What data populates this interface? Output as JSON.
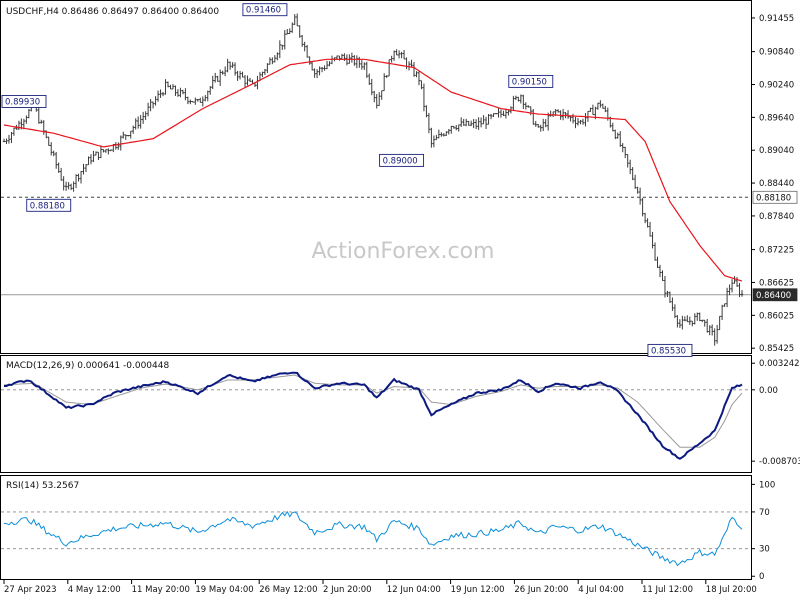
{
  "header": {
    "symbol_line": "USDCHF,H4  0.86486 0.86497 0.86400 0.86400"
  },
  "watermark": "ActionForex.com",
  "colors": {
    "candle": "#3a3a3a",
    "ma": "#e8151b",
    "macd": "#0c1a80",
    "macd_signal": "#9a9a9a",
    "rsi": "#0d8fd8",
    "label_border": "#1a237e",
    "label_text": "#1a237e",
    "current_price_bg": "#2b2b2b"
  },
  "chart_data": [
    {
      "type": "candlestick",
      "panel": "price",
      "y_ticks": [
        0.91455,
        0.9084,
        0.9024,
        0.8964,
        0.8904,
        0.8844,
        0.8784,
        0.87225,
        0.86625,
        0.86025,
        0.85425
      ],
      "y_tick_labels": [
        "0.91455",
        "0.90840",
        "0.90240",
        "0.89640",
        "0.89040",
        "0.88440",
        "0.87840",
        "0.87225",
        "0.86625",
        "0.86025",
        "0.85425"
      ],
      "ylim": [
        0.85355,
        0.9171
      ],
      "x_labels": [
        "27 Apr 2023",
        "4 May 12:00",
        "11 May 20:00",
        "19 May 04:00",
        "26 May 12:00",
        "2 Jun 20:00",
        "12 Jun 04:00",
        "19 Jun 12:00",
        "26 Jun 20:00",
        "4 Jul 04:00",
        "11 Jul 12:00",
        "18 Jul 20:00"
      ],
      "close_anchors": [
        [
          0,
          0.892
        ],
        [
          12,
          0.8985
        ],
        [
          25,
          0.883
        ],
        [
          35,
          0.889
        ],
        [
          45,
          0.8915
        ],
        [
          55,
          0.896
        ],
        [
          65,
          0.902
        ],
        [
          78,
          0.899
        ],
        [
          90,
          0.906
        ],
        [
          100,
          0.902
        ],
        [
          112,
          0.91
        ],
        [
          117,
          0.914
        ],
        [
          125,
          0.9045
        ],
        [
          135,
          0.9075
        ],
        [
          145,
          0.906
        ],
        [
          150,
          0.899
        ],
        [
          157,
          0.909
        ],
        [
          167,
          0.9035
        ],
        [
          172,
          0.8915
        ],
        [
          180,
          0.895
        ],
        [
          190,
          0.895
        ],
        [
          200,
          0.897
        ],
        [
          208,
          0.9005
        ],
        [
          215,
          0.894
        ],
        [
          222,
          0.8975
        ],
        [
          232,
          0.8955
        ],
        [
          240,
          0.899
        ],
        [
          247,
          0.8925
        ],
        [
          255,
          0.883
        ],
        [
          265,
          0.866
        ],
        [
          272,
          0.8585
        ],
        [
          280,
          0.86
        ],
        [
          286,
          0.856
        ],
        [
          290,
          0.863
        ],
        [
          293,
          0.8665
        ],
        [
          297,
          0.864
        ]
      ],
      "moving_average": {
        "period_label": "MA",
        "anchors": [
          [
            0,
            0.895
          ],
          [
            20,
            0.8935
          ],
          [
            40,
            0.891
          ],
          [
            60,
            0.8925
          ],
          [
            80,
            0.898
          ],
          [
            100,
            0.9025
          ],
          [
            115,
            0.906
          ],
          [
            130,
            0.907
          ],
          [
            145,
            0.907
          ],
          [
            165,
            0.9055
          ],
          [
            180,
            0.901
          ],
          [
            200,
            0.898
          ],
          [
            215,
            0.897
          ],
          [
            235,
            0.8965
          ],
          [
            250,
            0.896
          ],
          [
            258,
            0.892
          ],
          [
            268,
            0.881
          ],
          [
            280,
            0.873
          ],
          [
            290,
            0.8675
          ],
          [
            297,
            0.8665
          ]
        ]
      },
      "annotations": [
        {
          "text": "0.91460",
          "bar": 105,
          "price": 0.9146,
          "placement": "above"
        },
        {
          "text": "0.89930",
          "bar": 6,
          "price": 0.8993,
          "placement": "left-edge"
        },
        {
          "text": "0.89000",
          "bar": 160,
          "price": 0.89,
          "placement": "below"
        },
        {
          "text": "0.90150",
          "bar": 212,
          "price": 0.9015,
          "placement": "above"
        },
        {
          "text": "0.88180",
          "bar": 18,
          "price": 0.8818,
          "placement": "below"
        },
        {
          "text": "0.85530",
          "bar": 268,
          "price": 0.8553,
          "placement": "below"
        }
      ],
      "horizontal_lines": [
        {
          "price": 0.8818,
          "style": "dashed",
          "label": "0.88180"
        },
        {
          "price": 0.864,
          "style": "solid",
          "label": "0.86400",
          "current": true
        }
      ]
    },
    {
      "type": "line",
      "panel": "macd",
      "title": "MACD(12,26,9) 0.000641 -0.000448",
      "ylim": [
        -0.0099,
        0.004
      ],
      "y_tick_labels": [
        "0.003242",
        "0.00",
        "-0.008703"
      ],
      "y_ticks": [
        0.003242,
        0.0,
        -0.008703
      ],
      "series": [
        {
          "name": "MACD",
          "anchors": [
            [
              0,
              0.0005
            ],
            [
              10,
              0.0012
            ],
            [
              20,
              -0.001
            ],
            [
              25,
              -0.0022
            ],
            [
              35,
              -0.0018
            ],
            [
              45,
              -0.0003
            ],
            [
              55,
              0.0004
            ],
            [
              65,
              0.001
            ],
            [
              78,
              -0.0004
            ],
            [
              90,
              0.0018
            ],
            [
              100,
              0.001
            ],
            [
              112,
              0.002
            ],
            [
              117,
              0.0022
            ],
            [
              125,
              0.0002
            ],
            [
              135,
              0.0008
            ],
            [
              145,
              0.0006
            ],
            [
              150,
              -0.001
            ],
            [
              157,
              0.0012
            ],
            [
              167,
              0.0
            ],
            [
              172,
              -0.003
            ],
            [
              180,
              -0.0018
            ],
            [
              190,
              -0.0004
            ],
            [
              200,
              0.0
            ],
            [
              208,
              0.0012
            ],
            [
              215,
              -0.0002
            ],
            [
              222,
              0.0008
            ],
            [
              232,
              0.0002
            ],
            [
              240,
              0.001
            ],
            [
              247,
              -0.0002
            ],
            [
              255,
              -0.003
            ],
            [
              265,
              -0.0068
            ],
            [
              272,
              -0.0084
            ],
            [
              280,
              -0.0065
            ],
            [
              286,
              -0.005
            ],
            [
              290,
              -0.002
            ],
            [
              293,
              0.0002
            ],
            [
              297,
              0.0006
            ]
          ]
        },
        {
          "name": "Signal",
          "anchors": [
            [
              0,
              0.0006
            ],
            [
              12,
              0.0008
            ],
            [
              25,
              -0.0015
            ],
            [
              35,
              -0.0018
            ],
            [
              45,
              -0.0008
            ],
            [
              55,
              0.0002
            ],
            [
              65,
              0.0007
            ],
            [
              78,
              0.0
            ],
            [
              90,
              0.0012
            ],
            [
              100,
              0.0012
            ],
            [
              117,
              0.0018
            ],
            [
              125,
              0.0008
            ],
            [
              135,
              0.0006
            ],
            [
              145,
              0.0006
            ],
            [
              150,
              -0.0004
            ],
            [
              157,
              0.0004
            ],
            [
              167,
              0.0002
            ],
            [
              172,
              -0.0015
            ],
            [
              180,
              -0.0018
            ],
            [
              190,
              -0.0008
            ],
            [
              200,
              -0.0002
            ],
            [
              208,
              0.0006
            ],
            [
              215,
              0.0002
            ],
            [
              222,
              0.0004
            ],
            [
              232,
              0.0004
            ],
            [
              240,
              0.0006
            ],
            [
              247,
              0.0002
            ],
            [
              255,
              -0.0015
            ],
            [
              265,
              -0.0048
            ],
            [
              272,
              -0.007
            ],
            [
              280,
              -0.007
            ],
            [
              286,
              -0.0058
            ],
            [
              290,
              -0.0038
            ],
            [
              293,
              -0.0018
            ],
            [
              297,
              -0.0004
            ]
          ]
        }
      ],
      "zero_line": true
    },
    {
      "type": "line",
      "panel": "rsi",
      "title": "RSI(14) 53.2567",
      "ylim": [
        -3,
        108
      ],
      "y_ticks": [
        100,
        70,
        30,
        0
      ],
      "y_tick_labels": [
        "100",
        "70",
        "30",
        "0"
      ],
      "levels": [
        70,
        30
      ],
      "series": [
        {
          "name": "RSI",
          "anchors": [
            [
              0,
              58
            ],
            [
              10,
              62
            ],
            [
              20,
              44
            ],
            [
              25,
              36
            ],
            [
              35,
              45
            ],
            [
              45,
              52
            ],
            [
              55,
              55
            ],
            [
              65,
              58
            ],
            [
              78,
              48
            ],
            [
              90,
              62
            ],
            [
              100,
              55
            ],
            [
              112,
              66
            ],
            [
              117,
              68
            ],
            [
              125,
              48
            ],
            [
              135,
              56
            ],
            [
              145,
              54
            ],
            [
              150,
              40
            ],
            [
              157,
              60
            ],
            [
              167,
              52
            ],
            [
              172,
              34
            ],
            [
              180,
              44
            ],
            [
              190,
              46
            ],
            [
              200,
              50
            ],
            [
              208,
              58
            ],
            [
              215,
              46
            ],
            [
              222,
              54
            ],
            [
              232,
              50
            ],
            [
              240,
              55
            ],
            [
              247,
              46
            ],
            [
              255,
              34
            ],
            [
              265,
              20
            ],
            [
              272,
              14
            ],
            [
              280,
              26
            ],
            [
              286,
              24
            ],
            [
              290,
              44
            ],
            [
              293,
              64
            ],
            [
              297,
              54
            ]
          ]
        }
      ]
    }
  ]
}
